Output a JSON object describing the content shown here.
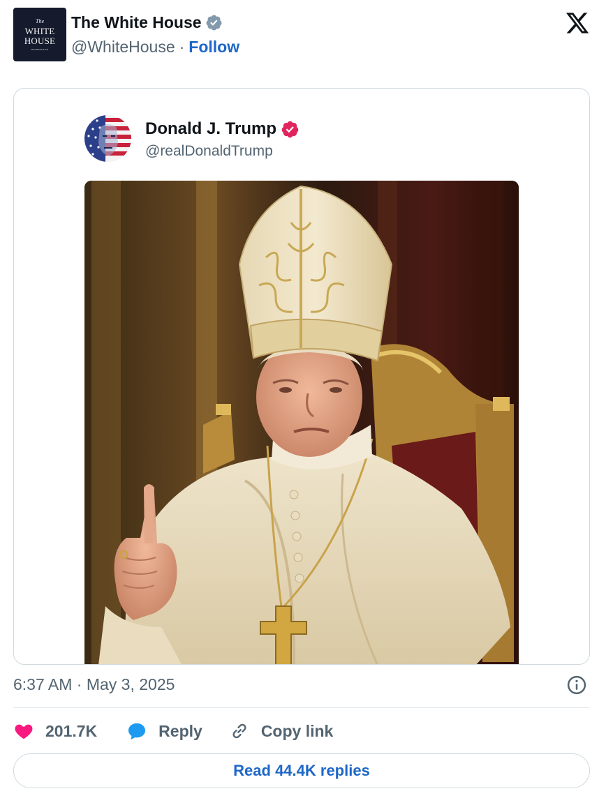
{
  "header": {
    "avatar": {
      "the": "The",
      "line1": "WHITE",
      "line2": "HOUSE",
      "line3": "WASHINGTON"
    },
    "display_name": "The White House",
    "handle": "@WhiteHouse",
    "separator": "·",
    "follow_label": "Follow",
    "verified_icon": "verified-badge-grey",
    "platform_icon": "x-logo"
  },
  "embedded_post": {
    "display_name": "Donald J. Trump",
    "handle": "@realDonaldTrump",
    "verified_icon": "verified-badge-pink",
    "media_icon": "photo"
  },
  "meta": {
    "timestamp": "6:37 AM · May 3, 2025",
    "info_icon": "info-icon"
  },
  "actions": {
    "like_count": "201.7K",
    "reply_label": "Reply",
    "copy_label": "Copy link"
  },
  "read_replies_label": "Read 44.4K replies",
  "colors": {
    "accent_blue": "#1d67c7",
    "like_pink": "#f91880",
    "reply_blue": "#1d9bf0",
    "verified_grey": "#829aab",
    "verified_pink": "#e0245e",
    "text_secondary": "#536471",
    "border": "#cfd9de"
  }
}
